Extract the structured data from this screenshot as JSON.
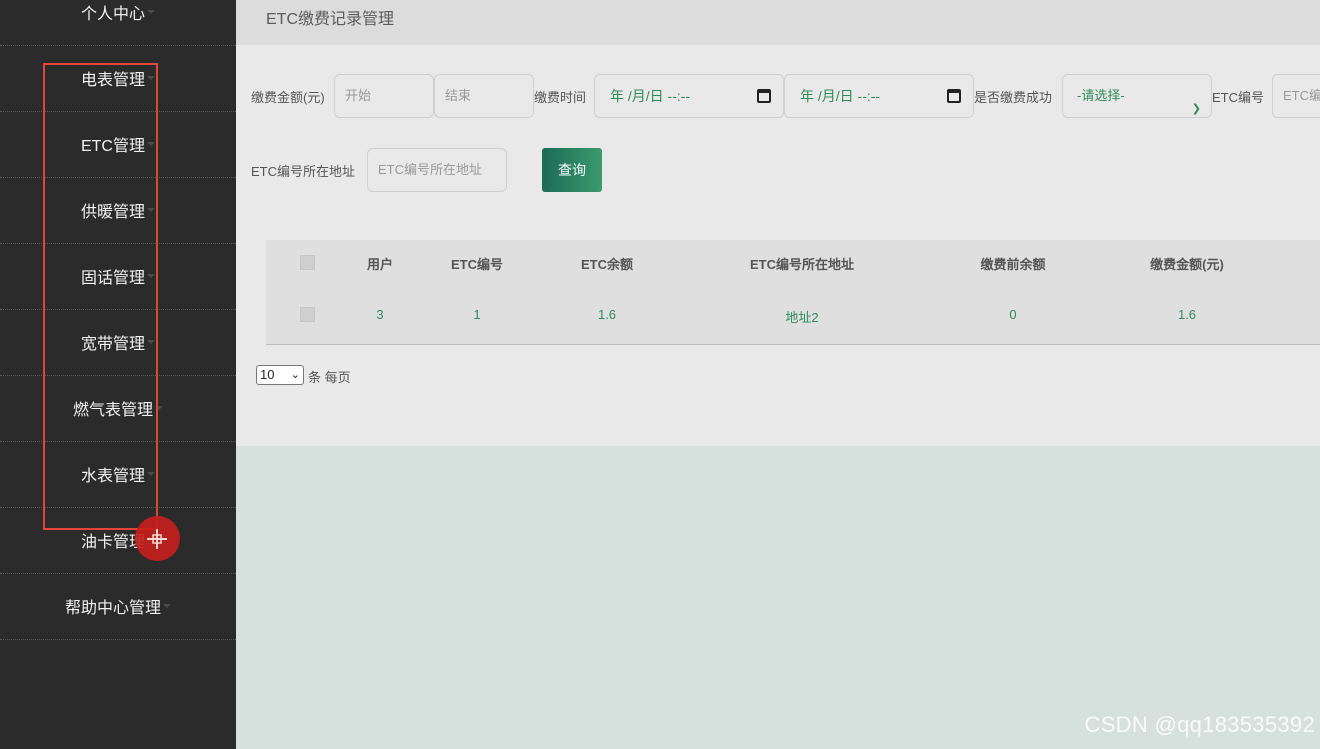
{
  "sidebar": {
    "items": [
      {
        "label": "个人中心"
      },
      {
        "label": "电表管理"
      },
      {
        "label": "ETC管理"
      },
      {
        "label": "供暖管理"
      },
      {
        "label": "固话管理"
      },
      {
        "label": "宽带管理"
      },
      {
        "label": "燃气表管理"
      },
      {
        "label": "水表管理"
      },
      {
        "label": "油卡管理"
      },
      {
        "label": "帮助中心管理"
      }
    ]
  },
  "header": {
    "title": "ETC缴费记录管理"
  },
  "filters": {
    "amount_label": "缴费金额(元)",
    "amount_start_placeholder": "开始",
    "amount_end_placeholder": "结束",
    "time_label": "缴费时间",
    "time_start": "年 /月/日 --:--",
    "time_end": "年 /月/日 --:--",
    "success_label": "是否缴费成功",
    "success_selected": "-请选择-",
    "etc_number_label": "ETC编号",
    "etc_number_placeholder": "ETC编号",
    "address_label": "ETC编号所在地址",
    "address_placeholder": "ETC编号所在地址",
    "search_button": "查询"
  },
  "table": {
    "columns": [
      "用户",
      "ETC编号",
      "ETC余额",
      "ETC编号所在地址",
      "缴费前余额",
      "缴费金额(元)"
    ],
    "rows": [
      [
        "3",
        "1",
        "1.6",
        "地址2",
        "0",
        "1.6"
      ]
    ]
  },
  "pagination": {
    "page_size": "10",
    "suffix": "条 每页"
  },
  "watermark": "CSDN @qq183535392",
  "colors": {
    "sidebar_bg": "#2b2b2b",
    "accent_green": "#2e8b57",
    "highlight_red": "#e4453a"
  }
}
